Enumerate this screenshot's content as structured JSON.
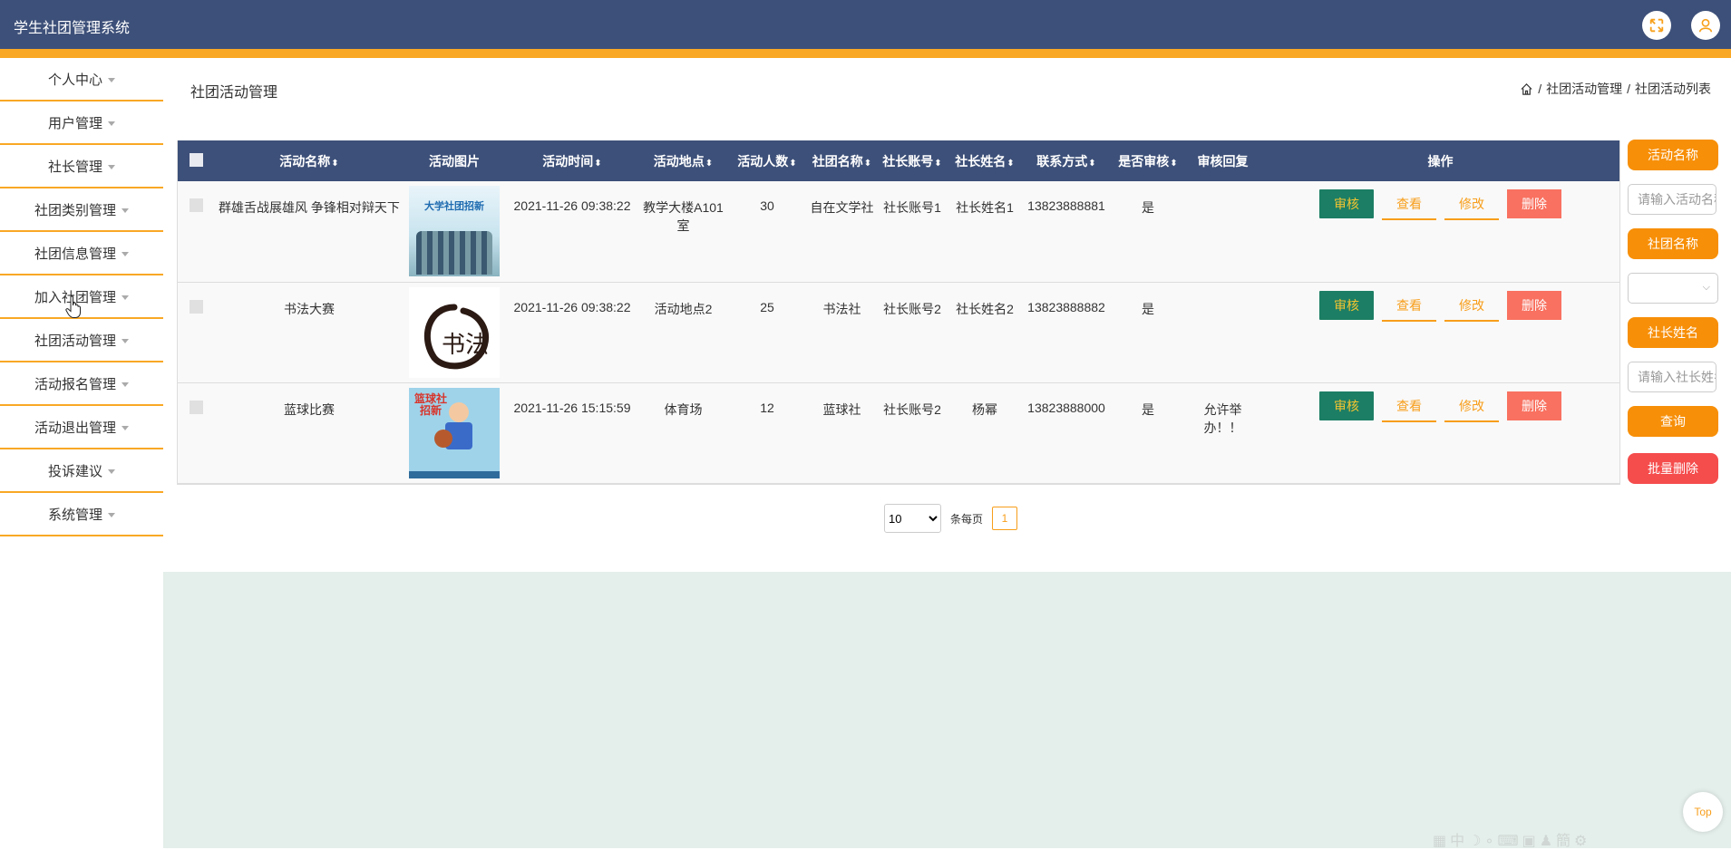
{
  "app": {
    "title": "学生社团管理系统"
  },
  "header": {
    "fullscreen_icon": "fullscreen-icon",
    "user_icon": "user-icon"
  },
  "sidebar": {
    "items": [
      {
        "label": "个人中心"
      },
      {
        "label": "用户管理"
      },
      {
        "label": "社长管理"
      },
      {
        "label": "社团类别管理"
      },
      {
        "label": "社团信息管理"
      },
      {
        "label": "加入社团管理"
      },
      {
        "label": "社团活动管理"
      },
      {
        "label": "活动报名管理"
      },
      {
        "label": "活动退出管理"
      },
      {
        "label": "投诉建议"
      },
      {
        "label": "系统管理"
      }
    ]
  },
  "page": {
    "title": "社团活动管理",
    "breadcrumb": [
      "社团活动管理",
      "社团活动列表"
    ]
  },
  "table": {
    "headers": [
      "活动名称",
      "活动图片",
      "活动时间",
      "活动地点",
      "活动人数",
      "社团名称",
      "社长账号",
      "社长姓名",
      "联系方式",
      "是否审核",
      "审核回复",
      "操作"
    ],
    "rows": [
      {
        "name": "群雄舌战展雄风 争锋相对辩天下",
        "time": "2021-11-26 09:38:22",
        "place": "教学大楼A101室",
        "count": "30",
        "club": "自在文学社",
        "leader_account": "社长账号1",
        "leader_name": "社长姓名1",
        "phone": "13823888881",
        "audited": "是",
        "reply": "",
        "image_text": "大学社团招新"
      },
      {
        "name": "书法大赛",
        "time": "2021-11-26 09:38:22",
        "place": "活动地点2",
        "count": "25",
        "club": "书法社",
        "leader_account": "社长账号2",
        "leader_name": "社长姓名2",
        "phone": "13823888882",
        "audited": "是",
        "reply": "",
        "image_text": "书法"
      },
      {
        "name": "蓝球比赛",
        "time": "2021-11-26 15:15:59",
        "place": "体育场",
        "count": "12",
        "club": "蓝球社",
        "leader_account": "社长账号2",
        "leader_name": "杨幂",
        "phone": "13823888000",
        "audited": "是",
        "reply": "允许举办！！",
        "image_text": "篮球社招新"
      }
    ],
    "actions": {
      "audit": "审核",
      "view": "查看",
      "edit": "修改",
      "delete": "删除"
    }
  },
  "search": {
    "activity_name_label": "活动名称",
    "activity_name_placeholder": "请输入活动名称",
    "club_name_label": "社团名称",
    "club_name_value": "",
    "leader_name_label": "社长姓名",
    "leader_name_placeholder": "请输入社长姓名",
    "query_button": "查询",
    "batch_delete_button": "批量删除"
  },
  "pagination": {
    "page_size": "10",
    "per_page_label": "条每页",
    "current_page": "1"
  },
  "back_to_top": "Top",
  "colors": {
    "header": "#3d5079",
    "accent": "#f9a825",
    "audit_btn": "#1c7e64",
    "delete_btn": "#fa5a46"
  }
}
